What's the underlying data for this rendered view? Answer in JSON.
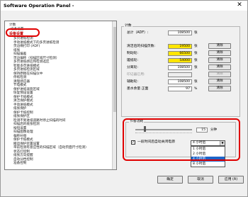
{
  "window": {
    "title": "Software Operation Panel -"
  },
  "tree": {
    "items": [
      "计数",
      "设备设置",
      "设备设置",
      "多页进纸检测",
      "手动进纸模式下的多页进纸检测",
      "页边缘打印 (ADF)",
      "纸张",
      "扫描偏差",
      "页边偏移（扫描区域尺寸检测）",
      "多页进纸感应和检测选区",
      "智能多页进纸模式",
      "多页进纸检测区域",
      "保持原稿在扫描仪中",
      "停纸检测",
      "清理感应器",
      "节电模式",
      "保护进纸滚筒区域",
      "恢复预设设置",
      "保护卡纸模式",
      "清洁保护模式",
      "手动进纸模式",
      "纸张保护",
      "保护卡纸控制",
      "纸张保护区",
      "检测不到进纸道路时停止扫描的时间",
      "扫描后的纸张检测",
      "按钮设置",
      "扫描图像处理",
      "偏移补偿",
      "保护卡纸模式",
      "搬运保护装置设置",
      "带前检测有意应性的扫描区域（自动页面尺寸检测）",
      "状态灯控制",
      "纸张方向提醒",
      "自动分档控制",
      "准备控制"
    ]
  },
  "counter": {
    "group_label": "计数",
    "total_label": "总计（ADF）:",
    "total_value": "108500",
    "total_unit": "张",
    "after_clean_label": "清洁后的扫描页数:",
    "after_clean_value": "19500",
    "after_clean_unit": "张",
    "brake_label": "制动轮:",
    "brake_value": "66500",
    "brake_unit": "张",
    "pick_label": "搓纸轮:",
    "pick_value": "54000",
    "pick_unit": "张",
    "separator_label": "分离轮:",
    "separator_value": "108500",
    "separator_unit": "张",
    "imprinter_label": "印记器已用:",
    "imprinter_value": "",
    "aux_label": "辅助轮:",
    "aux_value": "108500",
    "aux_unit": "张",
    "remain_label": "墨水余量 正面",
    "remain_value": "97",
    "remain_unit": "%",
    "clear_label": "清除"
  },
  "power": {
    "group_label": "节省功耗",
    "minutes_value": "15",
    "minutes_unit": "分钟",
    "checkbox_label": "一段时间后自动关闭电源",
    "select_value": "4 小时后",
    "options": [
      "1 小时后",
      "2 小时后",
      "4 小时后",
      "8 小时后"
    ]
  },
  "buttons": {
    "ok": "确定",
    "cancel": "取消",
    "apply": "应用 (A)"
  },
  "colors": {
    "accent_red": "#e00000",
    "highlight_yellow": "#ffe600",
    "selection_blue": "#1e64c8"
  }
}
